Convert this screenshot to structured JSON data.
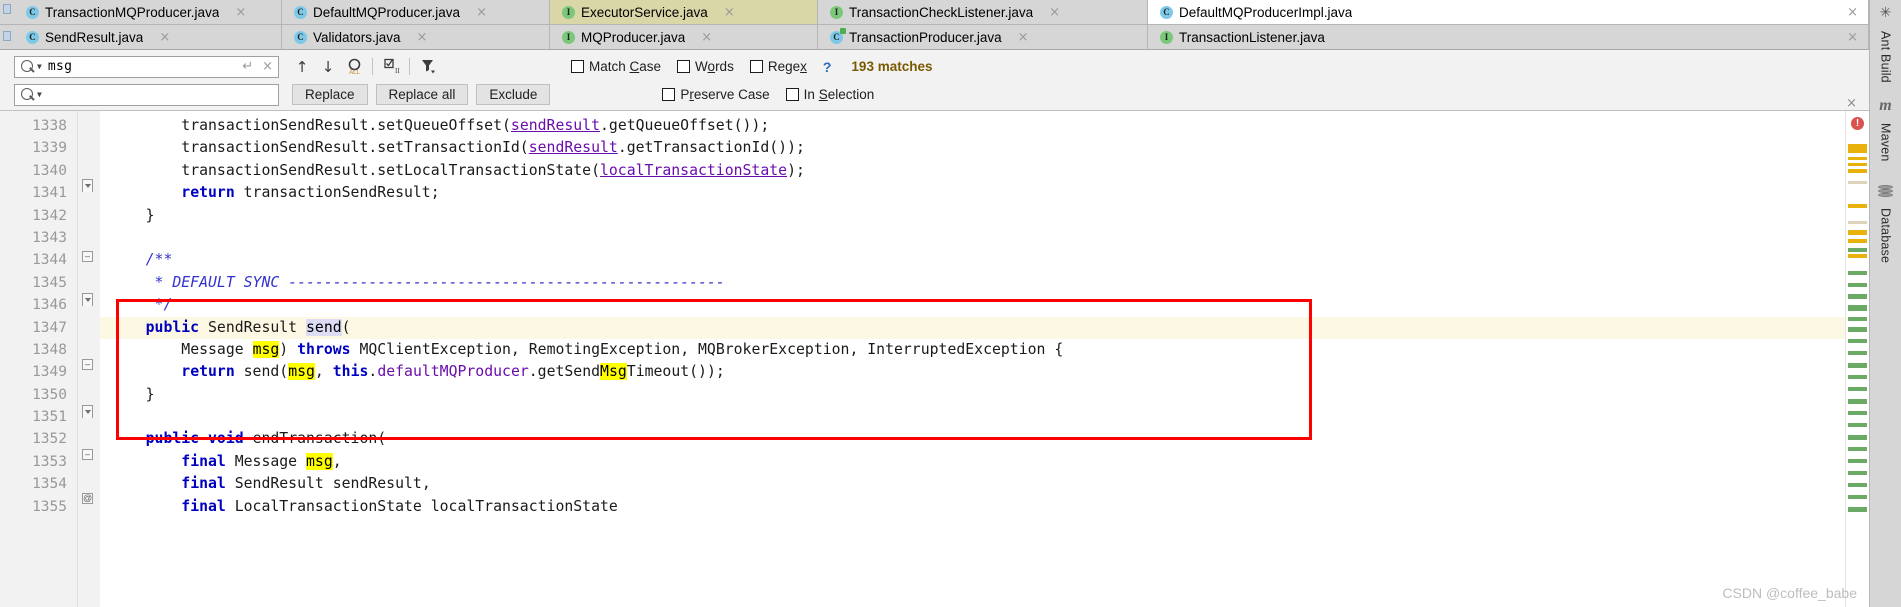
{
  "tabs_row1": [
    {
      "label": "TransactionMQProducer.java",
      "icon": "class-icon",
      "icon_kind": "c",
      "state": "inactive"
    },
    {
      "label": "DefaultMQProducer.java",
      "icon": "class-icon",
      "icon_kind": "c",
      "state": "inactive"
    },
    {
      "label": "ExecutorService.java",
      "icon": "interface-icon",
      "icon_kind": "i",
      "state": "active-olive"
    },
    {
      "label": "TransactionCheckListener.java",
      "icon": "interface-icon",
      "icon_kind": "i",
      "state": "inactive"
    },
    {
      "label": "DefaultMQProducerImpl.java",
      "icon": "class-icon",
      "icon_kind": "c",
      "state": "active-white"
    }
  ],
  "tabs_row2": [
    {
      "label": "SendResult.java",
      "icon": "class-icon",
      "icon_kind": "c",
      "state": "inactive"
    },
    {
      "label": "Validators.java",
      "icon": "class-icon",
      "icon_kind": "c",
      "state": "inactive"
    },
    {
      "label": "MQProducer.java",
      "icon": "interface-icon",
      "icon_kind": "i",
      "state": "inactive"
    },
    {
      "label": "TransactionProducer.java",
      "icon": "class-runnable-icon",
      "icon_kind": "ca",
      "state": "inactive"
    },
    {
      "label": "TransactionListener.java",
      "icon": "interface-icon",
      "icon_kind": "i",
      "state": "inactive"
    }
  ],
  "tab_close_label": "×",
  "find": {
    "search_value": "msg",
    "search_placeholder": "",
    "replace_value": "",
    "replace_placeholder": "",
    "enter_glyph": "↵",
    "clear_glyph": "×",
    "prev_match_glyph": "↑",
    "next_match_glyph": "↓",
    "match_count": "193 matches",
    "help_glyph": "?",
    "buttons": [
      {
        "label": "Replace",
        "name": "replace-button"
      },
      {
        "label": "Replace all",
        "name": "replace-all-button"
      },
      {
        "label": "Exclude",
        "name": "exclude-button"
      }
    ],
    "options_row1": [
      {
        "label_pre": "Match ",
        "label_u": "C",
        "label_post": "ase",
        "checked": false,
        "name": "match-case-checkbox"
      },
      {
        "label_pre": "W",
        "label_u": "o",
        "label_post": "rds",
        "checked": false,
        "name": "words-checkbox"
      },
      {
        "label_pre": "Rege",
        "label_u": "x",
        "label_post": "",
        "checked": false,
        "name": "regex-checkbox"
      }
    ],
    "options_row2": [
      {
        "label_pre": "P",
        "label_u": "r",
        "label_post": "eserve Case",
        "checked": false,
        "name": "preserve-case-checkbox"
      },
      {
        "label_pre": "In ",
        "label_u": "S",
        "label_post": "election",
        "checked": false,
        "name": "in-selection-checkbox"
      }
    ],
    "close_glyph": "×"
  },
  "editor": {
    "line_numbers": [
      "1338",
      "1339",
      "1340",
      "1341",
      "1342",
      "1343",
      "1344",
      "1345",
      "1346",
      "1347",
      "1348",
      "1349",
      "1350",
      "1351",
      "1352",
      "1353",
      "1354",
      "1355"
    ],
    "lines": [
      {
        "n": "1338",
        "indent": "        ",
        "tokens": [
          {
            "t": "transactionSendResult.setQueueOffset(",
            "c": "plain"
          },
          {
            "t": "sendResult",
            "c": "fld-u"
          },
          {
            "t": ".getQueueOffset());",
            "c": "plain"
          }
        ]
      },
      {
        "n": "1339",
        "indent": "        ",
        "tokens": [
          {
            "t": "transactionSendResult.setTransactionId(",
            "c": "plain"
          },
          {
            "t": "sendResult",
            "c": "fld-u"
          },
          {
            "t": ".getTransactionId());",
            "c": "plain"
          }
        ]
      },
      {
        "n": "1340",
        "indent": "        ",
        "tokens": [
          {
            "t": "transactionSendResult.setLocalTransactionState(",
            "c": "plain"
          },
          {
            "t": "localTransactionState",
            "c": "fld-u"
          },
          {
            "t": ");",
            "c": "plain"
          }
        ]
      },
      {
        "n": "1341",
        "indent": "        ",
        "tokens": [
          {
            "t": "return",
            "c": "kw"
          },
          {
            "t": " transactionSendResult;",
            "c": "plain"
          }
        ]
      },
      {
        "n": "1342",
        "indent": "    ",
        "tokens": [
          {
            "t": "}",
            "c": "plain"
          }
        ]
      },
      {
        "n": "1343",
        "indent": "",
        "tokens": []
      },
      {
        "n": "1344",
        "indent": "    ",
        "tokens": [
          {
            "t": "/**",
            "c": "cmt"
          }
        ]
      },
      {
        "n": "1345",
        "indent": "     ",
        "tokens": [
          {
            "t": "* DEFAULT SYNC -------------------------------------------------",
            "c": "cmt"
          }
        ]
      },
      {
        "n": "1346",
        "indent": "     ",
        "tokens": [
          {
            "t": "*/",
            "c": "cmt"
          }
        ]
      },
      {
        "n": "1347",
        "indent": "    ",
        "tokens": [
          {
            "t": "public",
            "c": "kw"
          },
          {
            "t": " SendResult ",
            "c": "plain"
          },
          {
            "t": "send",
            "c": "selword"
          },
          {
            "t": "(",
            "c": "plain"
          }
        ]
      },
      {
        "n": "1348",
        "indent": "        ",
        "tokens": [
          {
            "t": "Message ",
            "c": "plain"
          },
          {
            "t": "msg",
            "c": "hl"
          },
          {
            "t": ") ",
            "c": "plain"
          },
          {
            "t": "throws",
            "c": "kw"
          },
          {
            "t": " MQClientException, RemotingException, MQBrokerException, InterruptedException {",
            "c": "plain"
          }
        ]
      },
      {
        "n": "1349",
        "indent": "        ",
        "tokens": [
          {
            "t": "return",
            "c": "kw"
          },
          {
            "t": " send(",
            "c": "plain"
          },
          {
            "t": "msg",
            "c": "hl"
          },
          {
            "t": ", ",
            "c": "plain"
          },
          {
            "t": "this",
            "c": "kw"
          },
          {
            "t": ".",
            "c": "plain"
          },
          {
            "t": "defaultMQProducer",
            "c": "fld"
          },
          {
            "t": ".getSend",
            "c": "plain"
          },
          {
            "t": "Msg",
            "c": "hl"
          },
          {
            "t": "Timeout());",
            "c": "plain"
          }
        ]
      },
      {
        "n": "1350",
        "indent": "    ",
        "tokens": [
          {
            "t": "}",
            "c": "plain"
          }
        ]
      },
      {
        "n": "1351",
        "indent": "",
        "tokens": []
      },
      {
        "n": "1352",
        "indent": "    ",
        "tokens": [
          {
            "t": "public",
            "c": "kw"
          },
          {
            "t": " ",
            "c": "plain"
          },
          {
            "t": "void",
            "c": "kw"
          },
          {
            "t": " endTransaction(",
            "c": "plain"
          }
        ]
      },
      {
        "n": "1353",
        "indent": "        ",
        "tokens": [
          {
            "t": "final",
            "c": "kw"
          },
          {
            "t": " Message ",
            "c": "plain"
          },
          {
            "t": "msg",
            "c": "hl"
          },
          {
            "t": ",",
            "c": "plain"
          }
        ]
      },
      {
        "n": "1354",
        "indent": "        ",
        "tokens": [
          {
            "t": "final",
            "c": "kw"
          },
          {
            "t": " SendResult sendResult,",
            "c": "plain"
          }
        ]
      },
      {
        "n": "1355",
        "indent": "        ",
        "tokens": [
          {
            "t": "final",
            "c": "kw"
          },
          {
            "t": " LocalTransactionState localTransactionState",
            "c": "plain"
          }
        ]
      }
    ],
    "annotation_glyph": "@",
    "error_badge": "!",
    "annotation_color": "#ff0000"
  },
  "rightbar": {
    "items": [
      {
        "label": "Ant Build",
        "icon": "ant-icon",
        "name": "toolwindow-ant-build"
      },
      {
        "label": "Maven",
        "icon": "maven-icon",
        "name": "toolwindow-maven"
      },
      {
        "label": "Database",
        "icon": "database-icon",
        "name": "toolwindow-database"
      }
    ]
  },
  "watermark": "CSDN @coffee_babe"
}
